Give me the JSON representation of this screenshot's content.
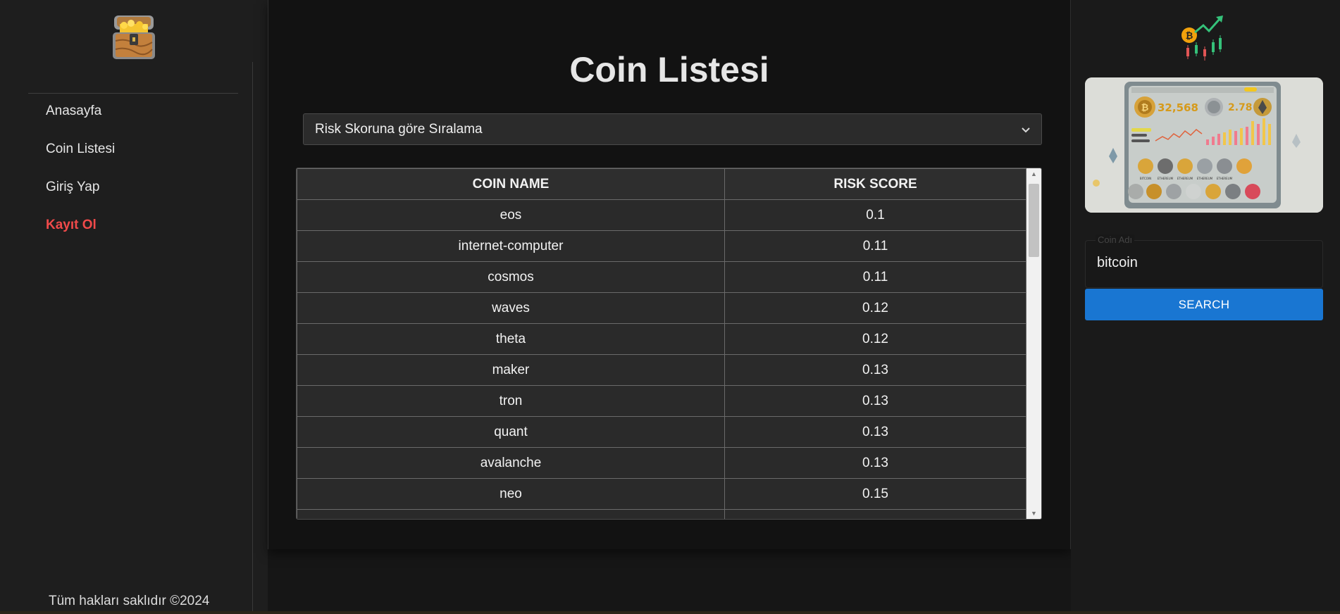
{
  "sidebar": {
    "logo_icon": "treasure-chest-icon",
    "nav": [
      {
        "label": "Anasayfa",
        "active": false
      },
      {
        "label": "Coin Listesi",
        "active": false
      },
      {
        "label": "Giriş Yap",
        "active": false
      },
      {
        "label": "Kayıt Ol",
        "active": true
      }
    ],
    "footer": "Tüm hakları saklıdır ©2024",
    "active_color": "#f04a4a"
  },
  "main": {
    "title": "Coin Listesi",
    "sort_select": {
      "selected": "Risk Skoruna göre Sıralama"
    },
    "table": {
      "headers": [
        "COIN NAME",
        "RISK SCORE"
      ],
      "rows": [
        [
          "eos",
          "0.1"
        ],
        [
          "internet-computer",
          "0.11"
        ],
        [
          "cosmos",
          "0.11"
        ],
        [
          "waves",
          "0.12"
        ],
        [
          "theta",
          "0.12"
        ],
        [
          "maker",
          "0.13"
        ],
        [
          "tron",
          "0.13"
        ],
        [
          "quant",
          "0.13"
        ],
        [
          "avalanche",
          "0.13"
        ],
        [
          "neo",
          "0.15"
        ]
      ]
    }
  },
  "right": {
    "chart_icon": "crypto-chart-icon",
    "hero_image": {
      "icon": "crypto-dashboard-illustration",
      "price_text": "32,568",
      "value_text": "2.78",
      "coin_labels": [
        "BITCOIN",
        "ETHEREUM",
        "ETHEREUM",
        "ETHEREUM",
        "ETHEREUM"
      ]
    },
    "search": {
      "legend": "Coin Adı",
      "value": "bitcoin",
      "button_label": "SEARCH"
    },
    "accent_color": "#1976d2"
  }
}
